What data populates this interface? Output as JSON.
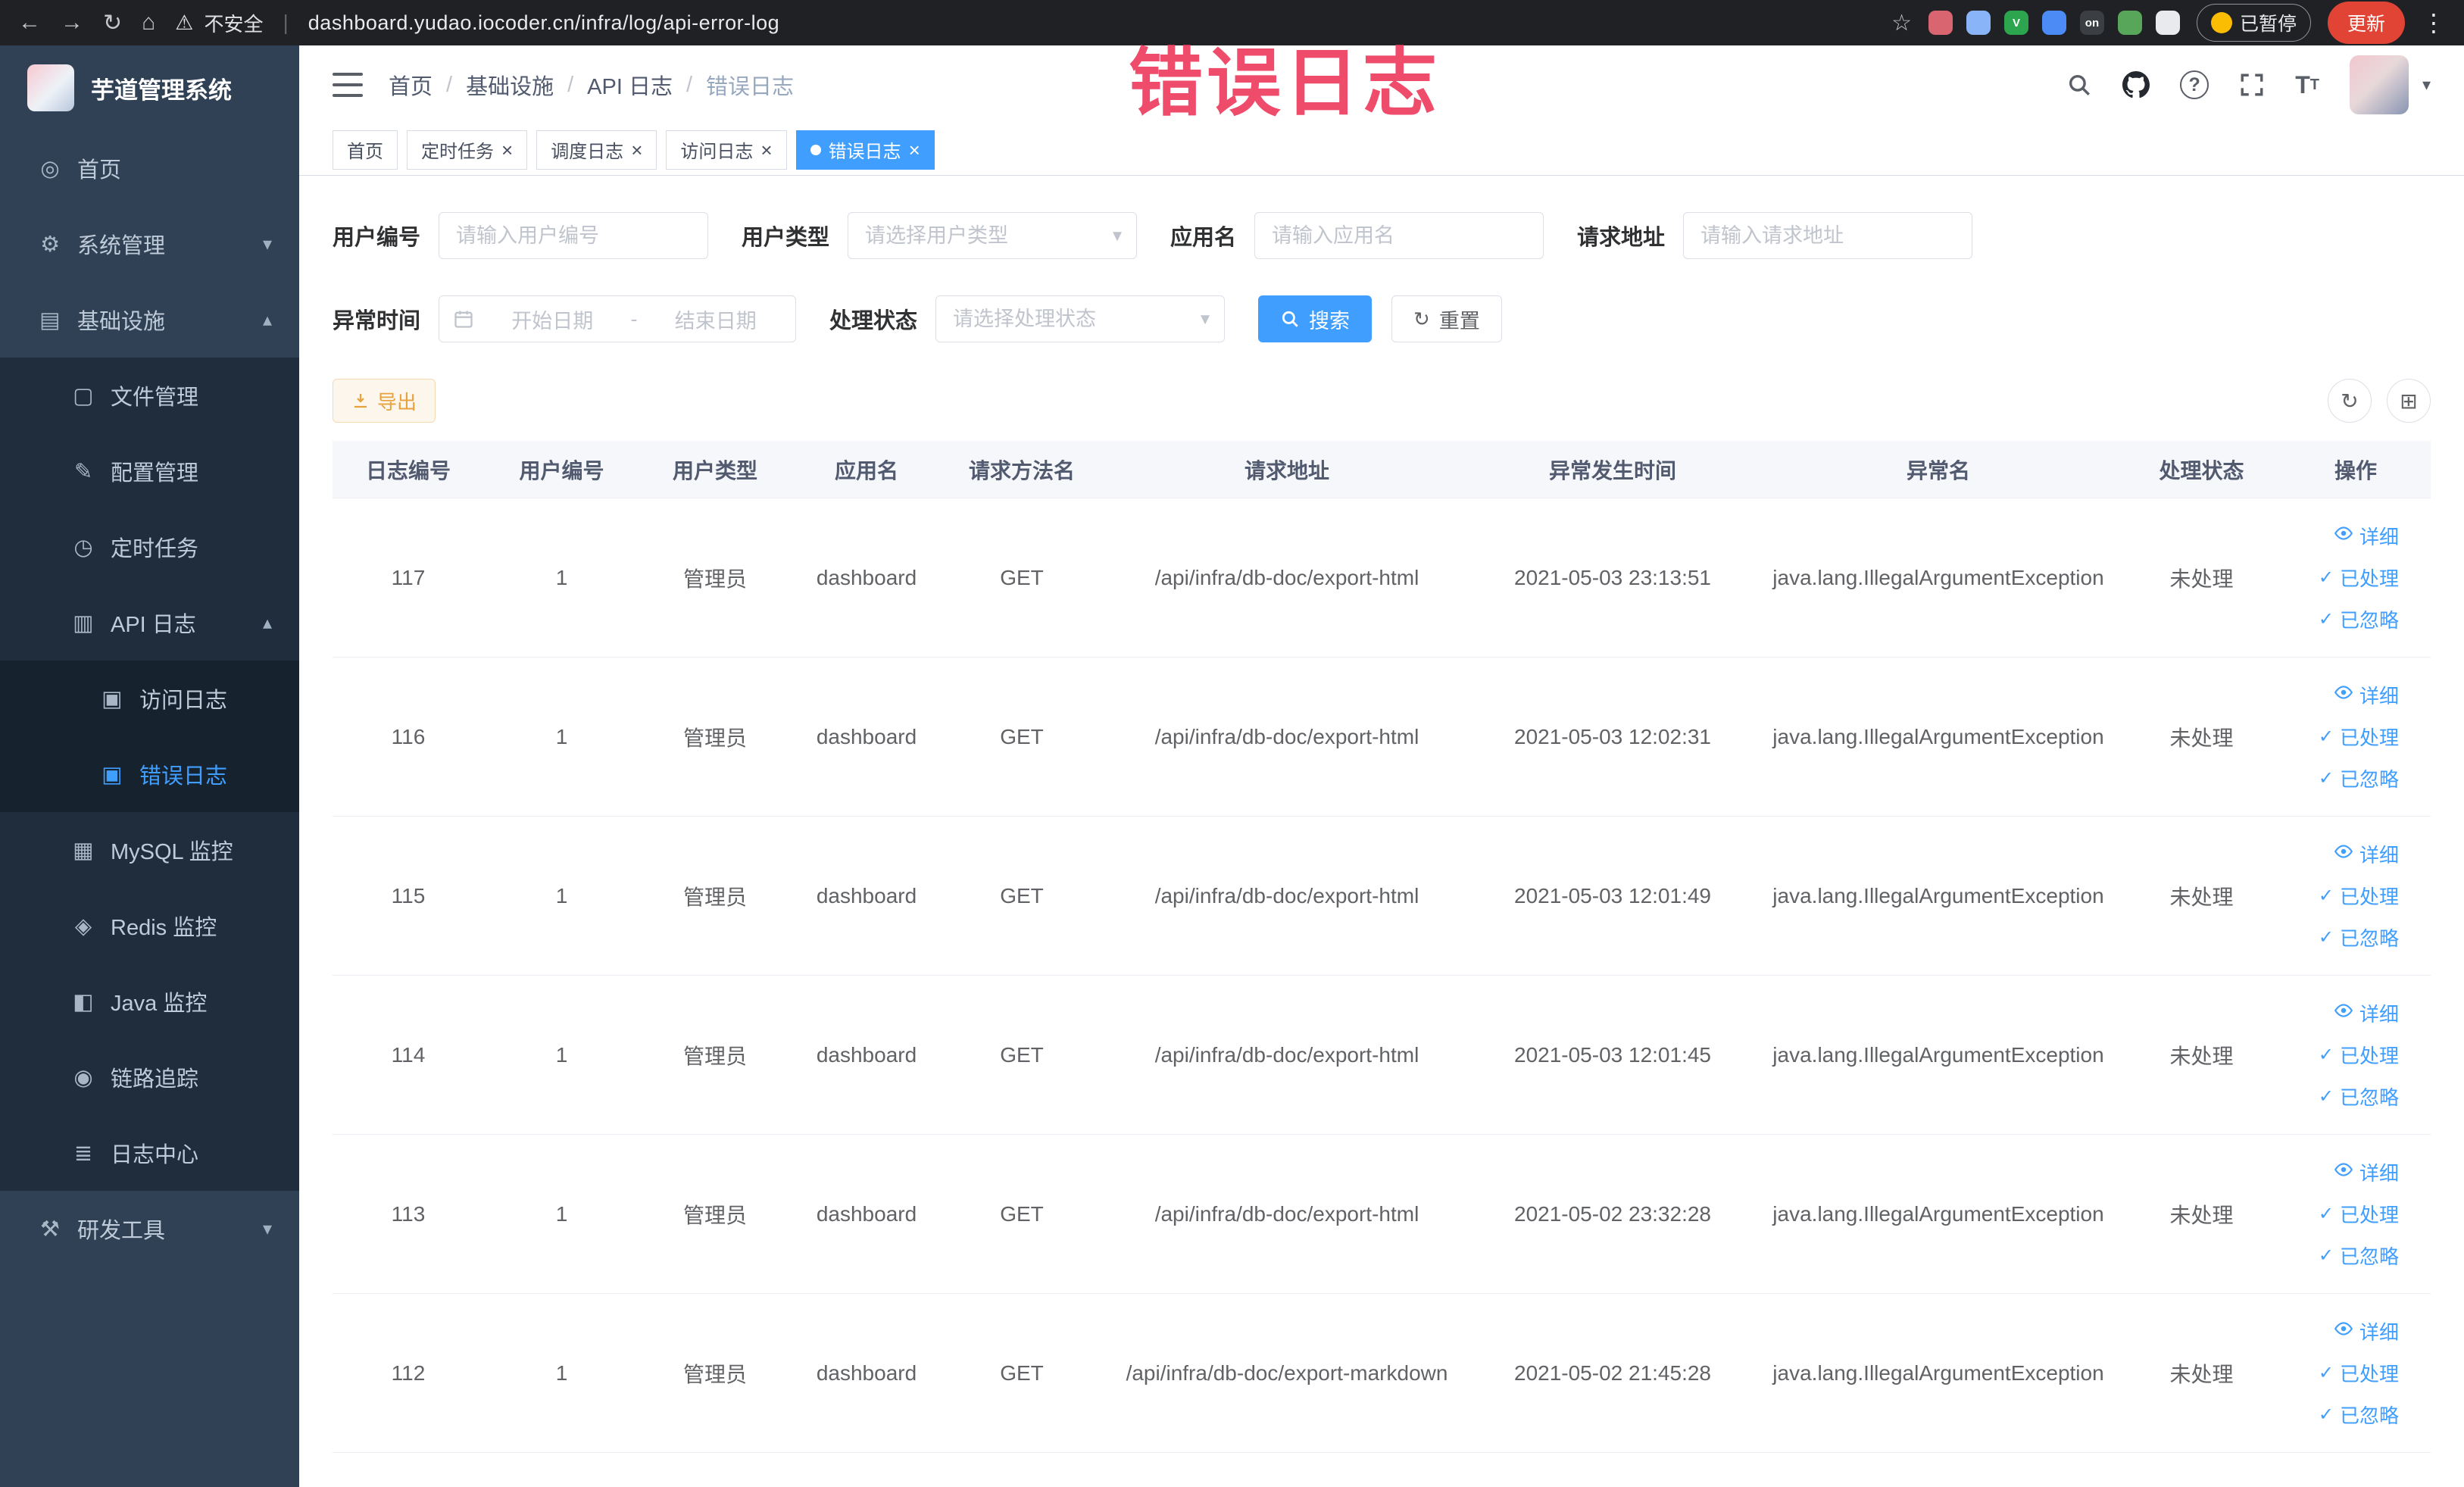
{
  "watermark": "错误日志",
  "colors": {
    "primary": "#409EFF",
    "warning": "#e6a23c",
    "sidebar_bg": "#304156",
    "sidebar_sub_bg": "#1f2d3d",
    "watermark_red": "#ee3c5f"
  },
  "browser": {
    "security_label": "不安全",
    "url": "dashboard.yudao.iocoder.cn/infra/log/api-error-log",
    "paused_badge": "已暂停",
    "update_button": "更新",
    "extensions": [
      {
        "name": "extension-red",
        "color": "#d96570",
        "letter": ""
      },
      {
        "name": "extension-lightblue",
        "color": "#8ab4f8",
        "letter": ""
      },
      {
        "name": "extension-green-v",
        "color": "#2da44e",
        "letter": "V"
      },
      {
        "name": "extension-blue-grid",
        "color": "#4c8bf5",
        "letter": ""
      },
      {
        "name": "extension-on-badge",
        "color": "#3b3e42",
        "letter": "on"
      },
      {
        "name": "extension-green-leaf",
        "color": "#57a65a",
        "letter": ""
      },
      {
        "name": "extension-paw",
        "color": "#e8eaed",
        "letter": ""
      }
    ]
  },
  "sidebar": {
    "title": "芋道管理系统",
    "menu": [
      {
        "name": "home",
        "label": "首页",
        "level": 1,
        "icon": "home-icon"
      },
      {
        "name": "system-management",
        "label": "系统管理",
        "level": 1,
        "icon": "gear-icon",
        "arrow": "down"
      },
      {
        "name": "infrastructure",
        "label": "基础设施",
        "level": 1,
        "icon": "infrastructure-icon",
        "arrow": "up"
      },
      {
        "name": "file-management",
        "label": "文件管理",
        "level": 2,
        "icon": "file-icon"
      },
      {
        "name": "config-management",
        "label": "配置管理",
        "level": 2,
        "icon": "config-icon"
      },
      {
        "name": "scheduled-jobs",
        "label": "定时任务",
        "level": 2,
        "icon": "timer-icon"
      },
      {
        "name": "api-log",
        "label": "API 日志",
        "level": 2,
        "icon": "api-log-icon",
        "arrow": "up"
      },
      {
        "name": "access-log",
        "label": "访问日志",
        "level": 3,
        "icon": "access-log-icon"
      },
      {
        "name": "error-log",
        "label": "错误日志",
        "level": 3,
        "icon": "error-log-icon",
        "active": true
      },
      {
        "name": "mysql-monitor",
        "label": "MySQL 监控",
        "level": 2,
        "icon": "mysql-icon"
      },
      {
        "name": "redis-monitor",
        "label": "Redis 监控",
        "level": 2,
        "icon": "redis-icon"
      },
      {
        "name": "java-monitor",
        "label": "Java 监控",
        "level": 2,
        "icon": "java-icon"
      },
      {
        "name": "trace",
        "label": "链路追踪",
        "level": 2,
        "icon": "trace-icon"
      },
      {
        "name": "log-center",
        "label": "日志中心",
        "level": 2,
        "icon": "log-center-icon"
      },
      {
        "name": "dev-tools",
        "label": "研发工具",
        "level": 1,
        "icon": "tools-icon",
        "arrow": "down"
      }
    ]
  },
  "header": {
    "breadcrumb": [
      "首页",
      "基础设施",
      "API 日志",
      "错误日志"
    ]
  },
  "tabs": [
    {
      "name": "home",
      "label": "首页",
      "closable": false,
      "active": false
    },
    {
      "name": "scheduled-jobs",
      "label": "定时任务",
      "closable": true,
      "active": false
    },
    {
      "name": "schedule-log",
      "label": "调度日志",
      "closable": true,
      "active": false
    },
    {
      "name": "access-log",
      "label": "访问日志",
      "closable": true,
      "active": false
    },
    {
      "name": "error-log",
      "label": "错误日志",
      "closable": true,
      "active": true
    }
  ],
  "filters": {
    "user_id": {
      "label": "用户编号",
      "placeholder": "请输入用户编号"
    },
    "user_type": {
      "label": "用户类型",
      "placeholder": "请选择用户类型"
    },
    "app_name": {
      "label": "应用名",
      "placeholder": "请输入应用名"
    },
    "request_url": {
      "label": "请求地址",
      "placeholder": "请输入请求地址"
    },
    "exception_time": {
      "label": "异常时间",
      "start_placeholder": "开始日期",
      "separator": "-",
      "end_placeholder": "结束日期"
    },
    "process_status": {
      "label": "处理状态",
      "placeholder": "请选择处理状态"
    },
    "search_button": "搜索",
    "reset_button": "重置"
  },
  "toolbar": {
    "export_label": "导出"
  },
  "table": {
    "columns": [
      {
        "key": "log_id",
        "label": "日志编号"
      },
      {
        "key": "user_id",
        "label": "用户编号"
      },
      {
        "key": "user_type",
        "label": "用户类型"
      },
      {
        "key": "app_name",
        "label": "应用名"
      },
      {
        "key": "method",
        "label": "请求方法名"
      },
      {
        "key": "url",
        "label": "请求地址"
      },
      {
        "key": "time",
        "label": "异常发生时间"
      },
      {
        "key": "exception",
        "label": "异常名"
      },
      {
        "key": "status",
        "label": "处理状态"
      },
      {
        "key": "actions",
        "label": "操作"
      }
    ],
    "actions": [
      {
        "name": "detail",
        "label": "详细",
        "icon": "eye-icon"
      },
      {
        "name": "processed",
        "label": "已处理",
        "icon": "check-icon"
      },
      {
        "name": "ignored",
        "label": "已忽略",
        "icon": "check-icon"
      }
    ],
    "rows": [
      {
        "log_id": "117",
        "user_id": "1",
        "user_type": "管理员",
        "app_name": "dashboard",
        "method": "GET",
        "url": "/api/infra/db-doc/export-html",
        "time": "2021-05-03 23:13:51",
        "exception": "java.lang.IllegalArgumentException",
        "status": "未处理"
      },
      {
        "log_id": "116",
        "user_id": "1",
        "user_type": "管理员",
        "app_name": "dashboard",
        "method": "GET",
        "url": "/api/infra/db-doc/export-html",
        "time": "2021-05-03 12:02:31",
        "exception": "java.lang.IllegalArgumentException",
        "status": "未处理"
      },
      {
        "log_id": "115",
        "user_id": "1",
        "user_type": "管理员",
        "app_name": "dashboard",
        "method": "GET",
        "url": "/api/infra/db-doc/export-html",
        "time": "2021-05-03 12:01:49",
        "exception": "java.lang.IllegalArgumentException",
        "status": "未处理"
      },
      {
        "log_id": "114",
        "user_id": "1",
        "user_type": "管理员",
        "app_name": "dashboard",
        "method": "GET",
        "url": "/api/infra/db-doc/export-html",
        "time": "2021-05-03 12:01:45",
        "exception": "java.lang.IllegalArgumentException",
        "status": "未处理"
      },
      {
        "log_id": "113",
        "user_id": "1",
        "user_type": "管理员",
        "app_name": "dashboard",
        "method": "GET",
        "url": "/api/infra/db-doc/export-html",
        "time": "2021-05-02 23:32:28",
        "exception": "java.lang.IllegalArgumentException",
        "status": "未处理"
      },
      {
        "log_id": "112",
        "user_id": "1",
        "user_type": "管理员",
        "app_name": "dashboard",
        "method": "GET",
        "url": "/api/infra/db-doc/export-markdown",
        "time": "2021-05-02 21:45:28",
        "exception": "java.lang.IllegalArgumentException",
        "status": "未处理"
      }
    ]
  }
}
